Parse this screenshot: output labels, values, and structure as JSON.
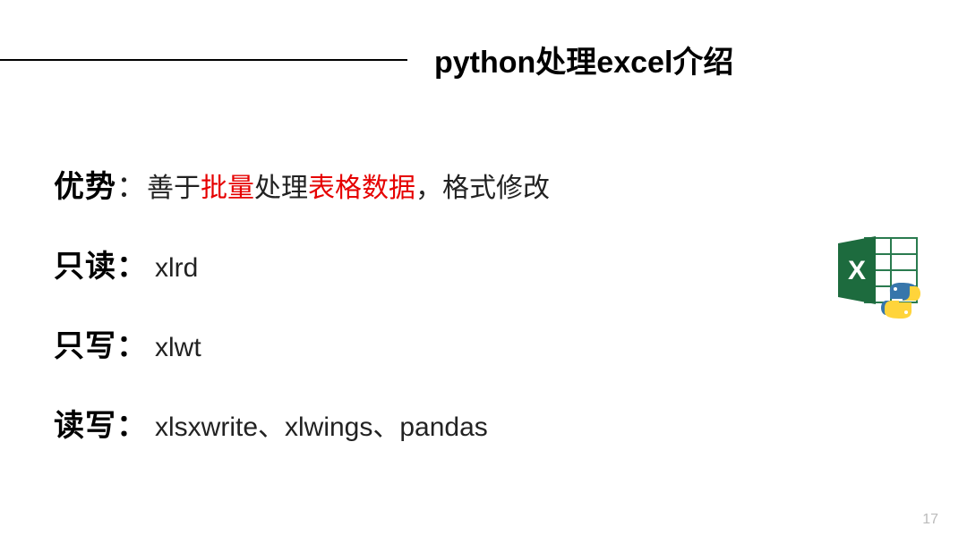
{
  "title": "python处理excel介绍",
  "rows": {
    "r1": {
      "label": "优势",
      "colon": "：",
      "v1": "善于",
      "v2": "批量",
      "v3": "处理",
      "v4": "表格数据",
      "v5": "，格式修改"
    },
    "r2": {
      "label": "只读：",
      "value": "xlrd"
    },
    "r3": {
      "label": "只写：",
      "value": "xlwt"
    },
    "r4": {
      "label": "读写：",
      "value": "xlsxwrite、xlwings、pandas"
    }
  },
  "page_number": "17"
}
